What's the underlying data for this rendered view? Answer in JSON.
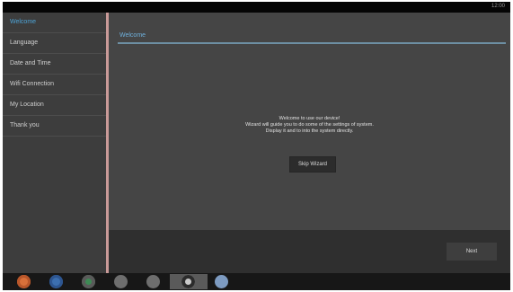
{
  "statusbar": {
    "time": "12:00"
  },
  "sidebar": {
    "items": [
      {
        "label": "Welcome",
        "active": true
      },
      {
        "label": "Language",
        "active": false
      },
      {
        "label": "Date and Time",
        "active": false
      },
      {
        "label": "Wifi Connection",
        "active": false
      },
      {
        "label": "My Location",
        "active": false
      },
      {
        "label": "Thank you",
        "active": false
      }
    ]
  },
  "content": {
    "title": "Welcome",
    "message": [
      "Welcome to use our device!",
      "Wizard will guide you to do some of the settings of system.",
      "Display it and to into the system directly."
    ],
    "skip_label": "Skip Wizard"
  },
  "footer": {
    "next_label": "Next"
  },
  "taskbar": {
    "icons": [
      {
        "name": "browser-icon",
        "color": "#d9703a"
      },
      {
        "name": "globe-icon",
        "color": "#3c6fb0"
      },
      {
        "name": "refresh-icon",
        "color": "#3e8a55"
      },
      {
        "name": "back-arrow-icon",
        "color": "#8a8a8a"
      },
      {
        "name": "volume-icon",
        "color": "#8a8a8a"
      },
      {
        "name": "home-icon",
        "color": "#c9c9c9"
      },
      {
        "name": "menu-icon",
        "color": "#7d9bc1"
      }
    ]
  }
}
